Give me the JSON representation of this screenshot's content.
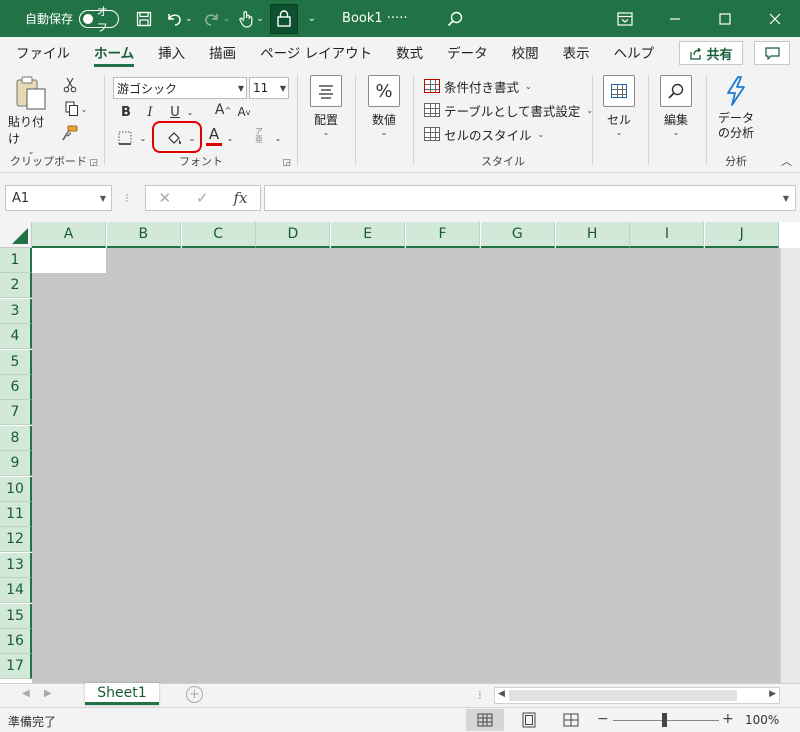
{
  "titlebar": {
    "autosave_label": "自動保存",
    "autosave_state": "オフ",
    "doc_title": "Book1 ·····",
    "bg_color": "#217346",
    "icons": [
      "save-icon",
      "undo-icon",
      "redo-icon",
      "touch-mode-icon",
      "lock-icon",
      "customize-qat-icon",
      "search-icon",
      "ribbon-display-icon",
      "minimize-icon",
      "maximize-icon",
      "close-icon"
    ]
  },
  "tabs": [
    "ファイル",
    "ホーム",
    "挿入",
    "描画",
    "ページ レイアウト",
    "数式",
    "データ",
    "校閲",
    "表示",
    "ヘルプ"
  ],
  "active_tab": "ホーム",
  "share_label": "共有",
  "ribbon": {
    "clipboard": {
      "paste_label": "貼り付け",
      "group_label": "クリップボード"
    },
    "font": {
      "font_name": "游ゴシック",
      "font_size": "11",
      "group_label": "フォント",
      "bold": "B",
      "italic": "I",
      "underline": "U",
      "increase_font": "A",
      "decrease_font": "A",
      "font_color_letter": "A",
      "phonetic_top": "ア",
      "phonetic_bottom": "亜",
      "font_color": "#e00000"
    },
    "alignment": {
      "label": "配置"
    },
    "number": {
      "label": "数値",
      "icon_text": "%"
    },
    "styles": {
      "conditional": "条件付き書式",
      "as_table": "テーブルとして書式設定",
      "cell_styles": "セルのスタイル",
      "group_label": "スタイル"
    },
    "cells": {
      "label": "セル"
    },
    "editing": {
      "label": "編集"
    },
    "analysis": {
      "button_line1": "データ",
      "button_line2": "の分析",
      "group_label": "分析"
    }
  },
  "formula_bar": {
    "name_box": "A1",
    "cancel_symbol": "✕",
    "enter_symbol": "✓",
    "fx_symbol": "fx",
    "value": ""
  },
  "grid": {
    "columns": [
      "A",
      "B",
      "C",
      "D",
      "E",
      "F",
      "G",
      "H",
      "I",
      "J"
    ],
    "rows": [
      "1",
      "2",
      "3",
      "4",
      "5",
      "6",
      "7",
      "8",
      "9",
      "10",
      "11",
      "12",
      "13",
      "14",
      "15",
      "16",
      "17"
    ],
    "active_cell": "A1"
  },
  "sheets": [
    "Sheet1"
  ],
  "status": {
    "text": "準備完了",
    "zoom": "100%"
  }
}
